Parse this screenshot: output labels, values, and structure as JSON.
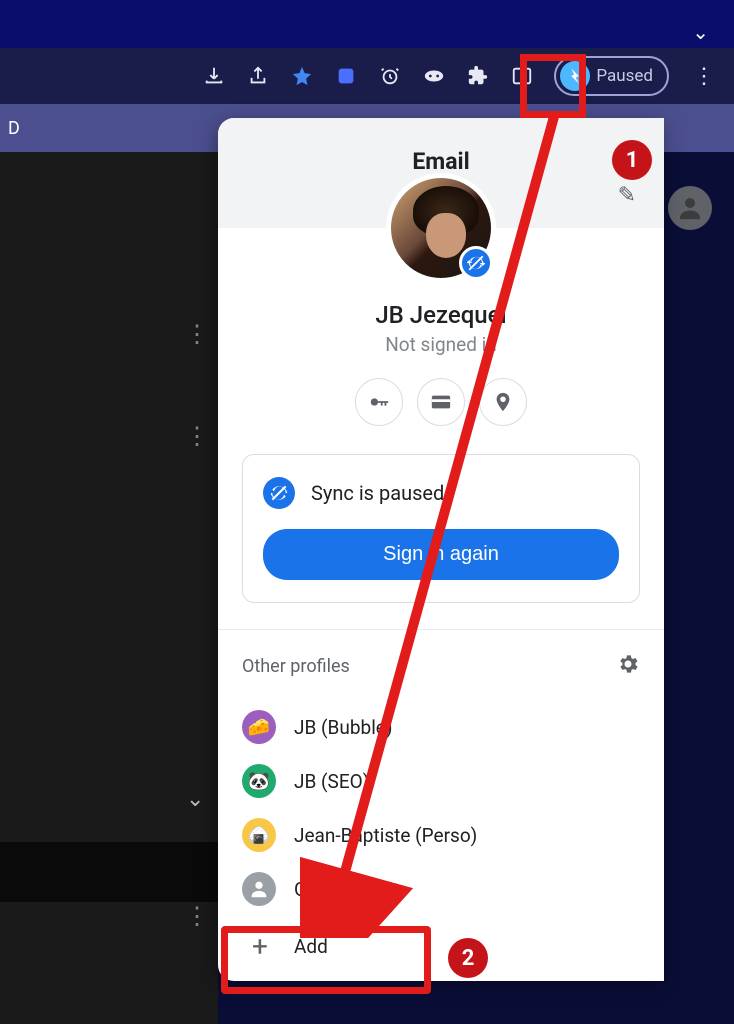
{
  "topbar": {},
  "toolbar": {
    "paused_label": "Paused"
  },
  "secondary": {
    "letter": "D"
  },
  "panel": {
    "header": "Email",
    "name": "JB Jezequel",
    "status": "Not signed in",
    "sync_text": "Sync is paused",
    "signin_label": "Sign in again",
    "other_label": "Other profiles",
    "profiles": [
      {
        "label": "JB (Bubble)",
        "color": "#9c5fbf",
        "emoji": "🧀"
      },
      {
        "label": "JB (SEO)",
        "color": "#1fab6e",
        "emoji": "🐼"
      },
      {
        "label": "Jean-Baptiste (Perso)",
        "color": "#f9c646",
        "emoji": "🍙"
      },
      {
        "label": "Guest",
        "color": "#9aa0a6",
        "emoji": ""
      }
    ],
    "add_label": "Add"
  },
  "annotations": {
    "one": "1",
    "two": "2"
  }
}
